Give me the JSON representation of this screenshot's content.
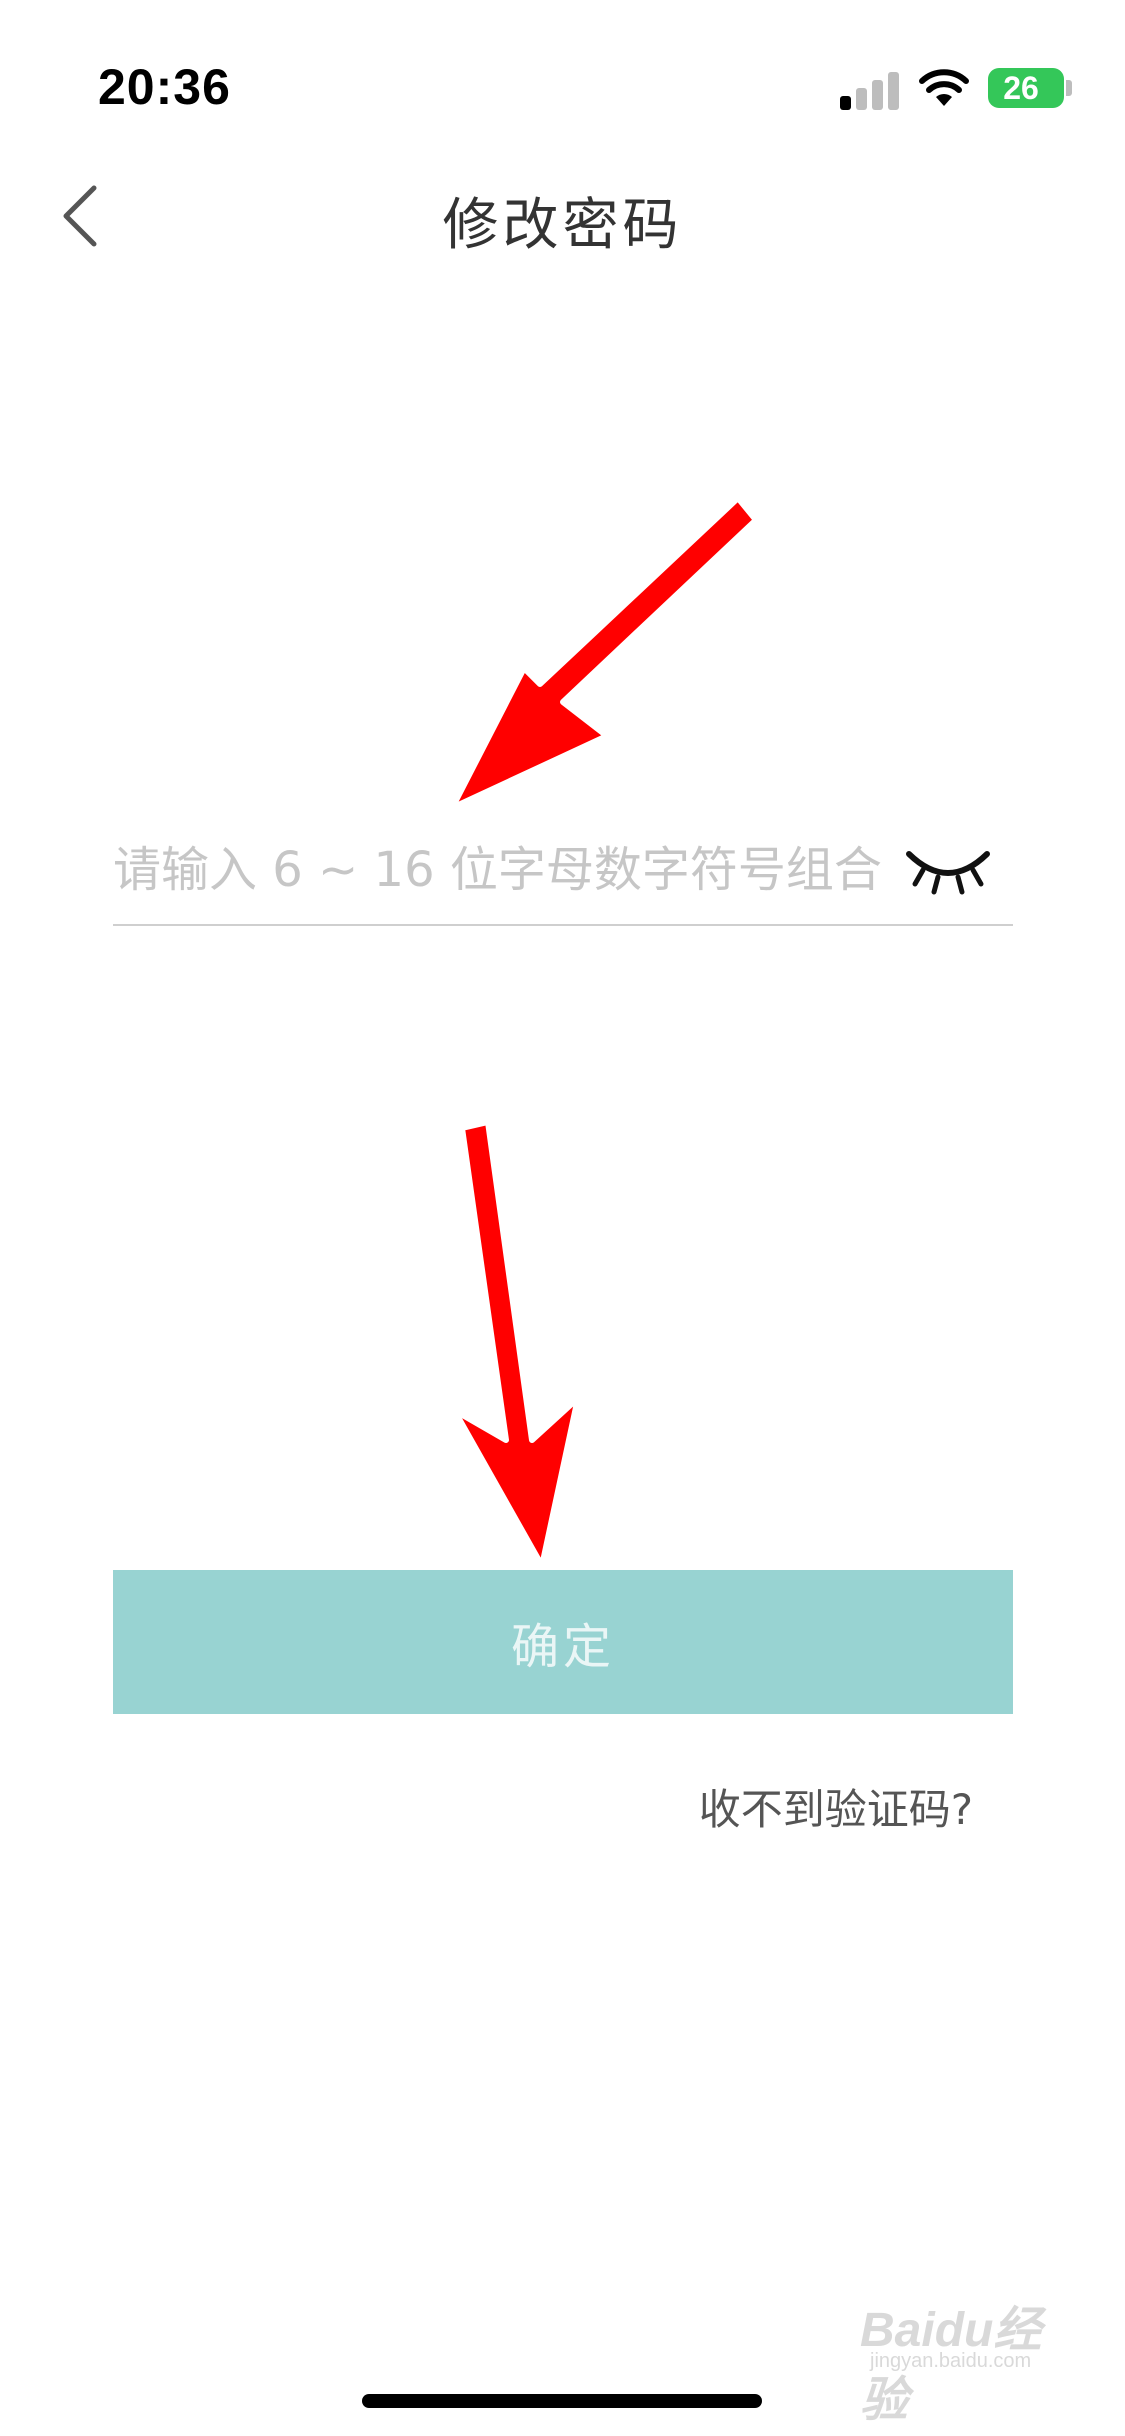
{
  "status_bar": {
    "time": "20:36",
    "battery_level": "26",
    "battery_color": "#34c759",
    "signal_bars_on": 1,
    "signal_bars_total": 4
  },
  "nav": {
    "back_icon": "chevron-left-icon",
    "title": "修改密码"
  },
  "password_field": {
    "value": "",
    "placeholder": "请输入 6 ~ 16 位字母数字符号组合",
    "visibility_icon": "eye-closed-icon"
  },
  "confirm_button": {
    "label": "确定",
    "color": "#98d3d2"
  },
  "no_code_link": "收不到验证码?",
  "watermark": {
    "logo": "Baidu经验",
    "url": "jingyan.baidu.com"
  },
  "annotation_color": "#ff0000"
}
